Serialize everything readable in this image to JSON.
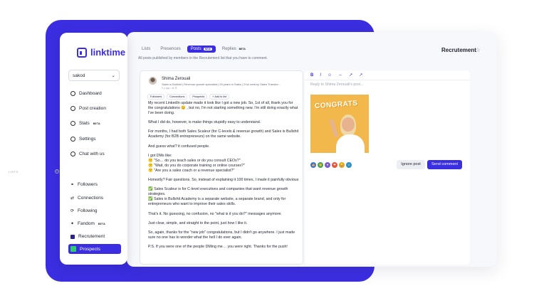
{
  "brand": {
    "name": "linktime",
    "accent": "#3b2ee0"
  },
  "sidebar": {
    "workspace": "sakod",
    "nav": [
      {
        "label": "Dashboard",
        "icon": "dashboard-icon"
      },
      {
        "label": "Post creation",
        "icon": "pencil-icon"
      },
      {
        "label": "Stats",
        "icon": "stats-icon",
        "badge": "BETA"
      },
      {
        "label": "Settings",
        "icon": "gear-icon"
      },
      {
        "label": "Chat with us",
        "icon": "chat-icon"
      }
    ],
    "lists_label": "LISTS",
    "lists": [
      {
        "label": "Followers",
        "icon": "followers-icon"
      },
      {
        "label": "Connections",
        "icon": "connections-icon"
      },
      {
        "label": "Following",
        "icon": "following-icon"
      },
      {
        "label": "Fandom",
        "icon": "fandom-icon",
        "badge": "BETA"
      },
      {
        "label": "Recrutement",
        "color": "#2b2490"
      },
      {
        "label": "Prospects",
        "color": "#2ecc71",
        "active": true
      }
    ]
  },
  "header": {
    "tabs": [
      {
        "label": "Lists"
      },
      {
        "label": "Presences"
      },
      {
        "label": "Posts",
        "badge": "NEW",
        "active": true
      },
      {
        "label": "Replies",
        "badge": "BETA"
      }
    ],
    "subtitle": "All posts published by members in the Recrutement list that you have to comment.",
    "page_title": "Recrutement"
  },
  "post": {
    "author": "Shima Zerouali",
    "headline": "Sales is Bullshit | Revenue growth specialist | 25 years in Sales | 21st century Sales Transfor...",
    "time": "2 y ago • ⊕ ☰",
    "chips": [
      "Followers",
      "Connections",
      "Prospects",
      "+ Add to list"
    ],
    "paragraphs": [
      "My recent LinkedIn update made it look like I got a new job. So, 1st of all, thank you for the congratulations 😊 , but no, I'm not starting something new. I'm still doing exactly what I've been doing.",
      "What I did do, however, is make things stupidly easy to understand.",
      "For months, I had both Sales Scaleur (for C-levels & revenue growth) and Sales is Bullshit Academy (for B2B entrepreneurs) on the same website.",
      "And guess what? it confused people.",
      "I got DMs like:\n😕 \"So… do you teach sales or do you consult CEOs?\"\n😕 \"Wait, do you do corporate training or online courses?\"\n😕 \"Are you a sales coach or a revenue specialist?\"",
      "Honestly? Fair questions. So, instead of explaining it 100 times, I made it painfully obvious",
      "✅ Sales Scaleur is for C-level executives and companies that want revenue growth strategies.\n✅ Sales is Bullshit Academy is a separate website, a separate brand, and only for entrepreneurs who want to improve their sales skills.",
      "That's it. No guessing, no confusion, no \"what is it you do?\" messages anymore.",
      "Just clear, simple, and straight to the point, just how I like it.",
      "So, again, thanks for the \"new job\" congratulations, but I didn't go anywhere. I just made sure no one has to wonder what the hell I do ever again.",
      "P.S. If you were one of the people DMing me… you were right. Thanks for the push!"
    ]
  },
  "reply": {
    "toolbar": [
      "B",
      "I",
      "☺",
      "⇔",
      "↗",
      "↗"
    ],
    "placeholder": "Reply to Shima Zerouali's post...",
    "image_text": "CONGRATS",
    "reactions": [
      {
        "icon": "like-reaction-icon",
        "color": "#3b6fd8",
        "glyph": "👍"
      },
      {
        "icon": "celebrate-reaction-icon",
        "color": "#44a05a",
        "glyph": "👏"
      },
      {
        "icon": "support-reaction-icon",
        "color": "#7a5bc8",
        "glyph": "♥"
      },
      {
        "icon": "love-reaction-icon",
        "color": "#e05a3c",
        "glyph": "❤"
      },
      {
        "icon": "insightful-reaction-icon",
        "color": "#e0a22c",
        "glyph": "💡"
      },
      {
        "icon": "funny-reaction-icon",
        "color": "#2f8fbd",
        "glyph": "☺"
      }
    ],
    "ignore_label": "Ignore post",
    "send_label": "Send comment"
  }
}
